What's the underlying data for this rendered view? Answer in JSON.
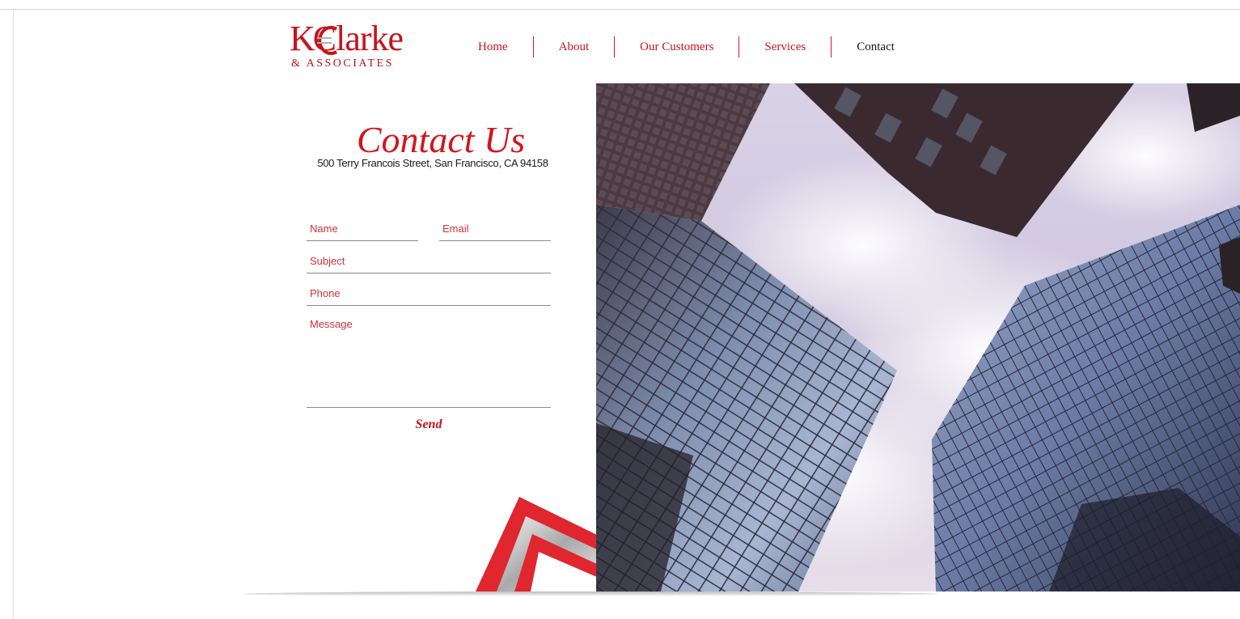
{
  "brand": {
    "logo_text": "Clarke",
    "logo_initial": "K",
    "logo_sub": "& ASSOCIATES",
    "primary_color": "#c8141d"
  },
  "nav": {
    "items": [
      {
        "label": "Home",
        "active": false
      },
      {
        "label": "About",
        "active": false
      },
      {
        "label": "Our Customers",
        "active": false
      },
      {
        "label": "Services",
        "active": false
      },
      {
        "label": "Contact",
        "active": true
      }
    ]
  },
  "contact": {
    "title": "Contact Us",
    "address": "500 Terry Francois Street, San Francisco, CA 94158",
    "form": {
      "name_placeholder": "Name",
      "email_placeholder": "Email",
      "subject_placeholder": "Subject",
      "phone_placeholder": "Phone",
      "message_placeholder": "Message",
      "send_label": "Send"
    }
  },
  "hero": {
    "icon": "skyscrapers-photo"
  }
}
